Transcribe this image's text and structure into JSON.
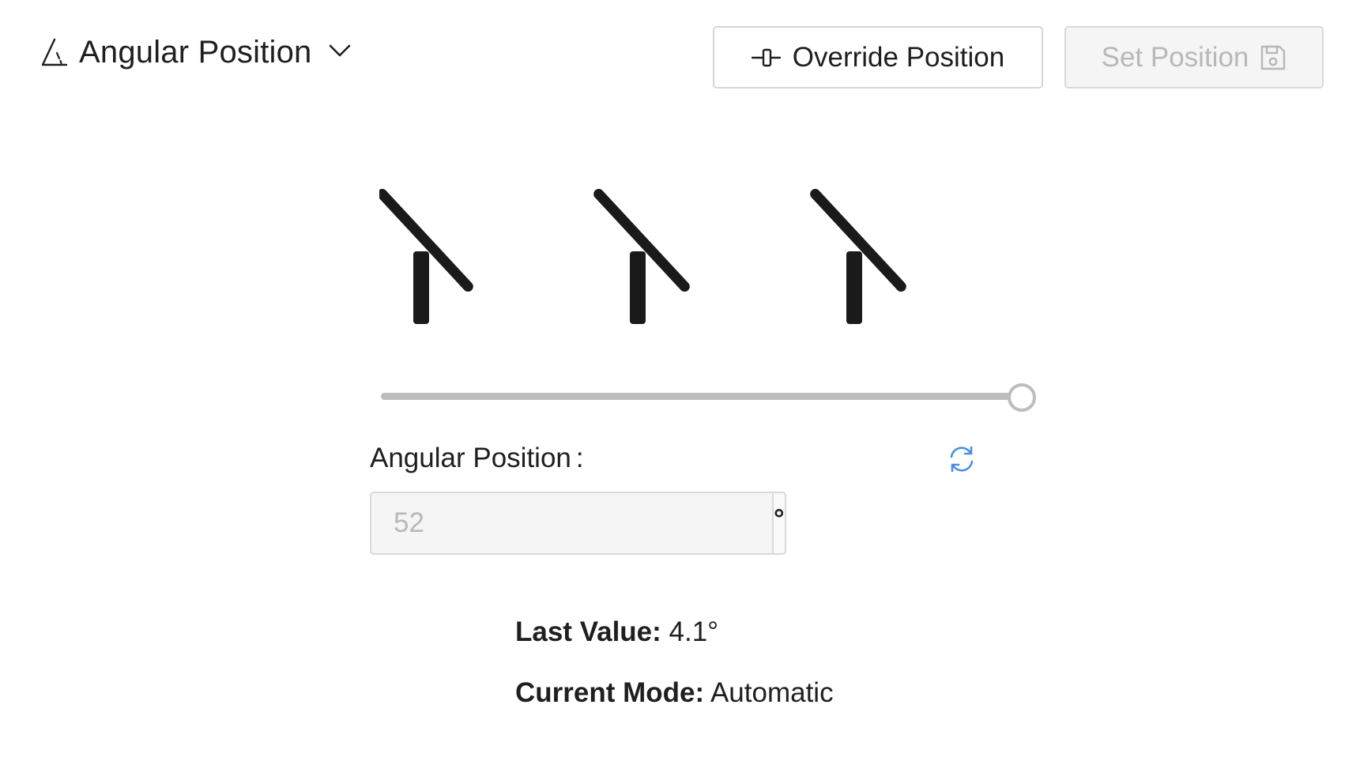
{
  "header": {
    "title": "Angular Position",
    "title_icon": "angle-icon",
    "dropdown_icon": "chevron-down-icon",
    "override_button": {
      "label": "Override Position",
      "icon": "override-icon"
    },
    "set_button": {
      "label": "Set Position",
      "icon": "save-icon",
      "disabled": true
    }
  },
  "visualization": {
    "shutter_count": 3,
    "tilt_angle_deg": 52
  },
  "slider": {
    "min": 0,
    "max": 1,
    "value": 1.0
  },
  "form": {
    "label": "Angular Position",
    "label_suffix": ":",
    "refresh_icon": "refresh-icon",
    "input_placeholder": "52",
    "unit": "°"
  },
  "status": {
    "last_value_key": "Last Value:",
    "last_value": "4.1°",
    "mode_key": "Current Mode:",
    "mode_value": "Automatic"
  },
  "colors": {
    "text": "#1f1f1f",
    "disabled_text": "#b8b8b8",
    "border": "#d9d9d9",
    "accent": "#4a90e2",
    "shutter": "#1a1a1a",
    "slider_track": "#bdbdbd"
  }
}
